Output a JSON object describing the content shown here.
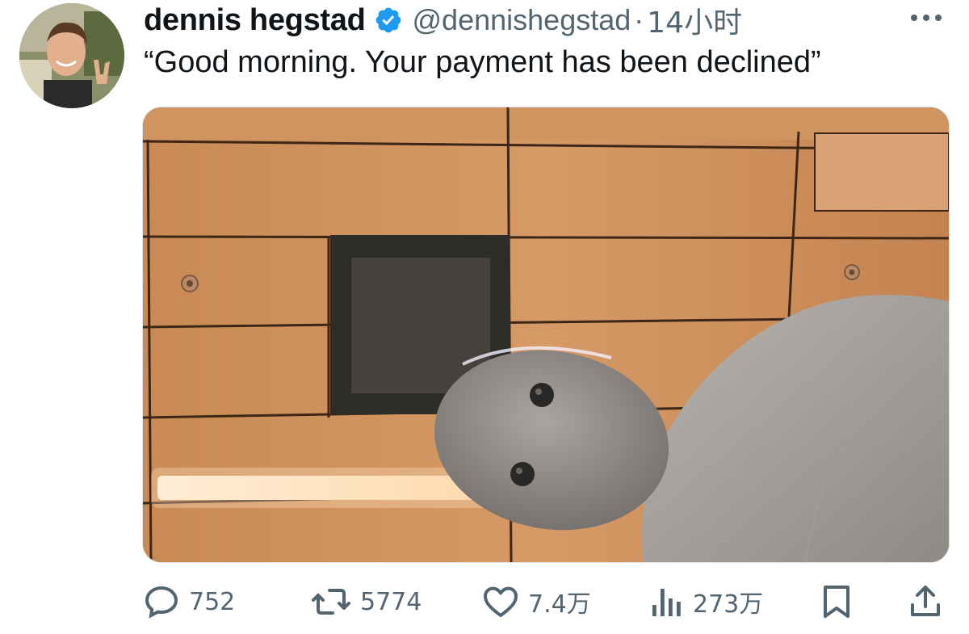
{
  "tweet": {
    "display_name": "dennis hegstad",
    "handle": "@dennishegstad",
    "separator": "·",
    "time": "14小时",
    "verified": true,
    "text": "“Good morning. Your payment has been declined”"
  },
  "actions": {
    "replies": "752",
    "retweets": "5774",
    "likes": "7.4万",
    "views": "273万"
  },
  "icons": {
    "reply": "speech-bubble-icon",
    "retweet": "retweet-arrows-icon",
    "like": "heart-icon",
    "views": "bar-chart-icon",
    "bookmark": "bookmark-icon",
    "share": "share-upload-icon",
    "more": "more-dots-icon",
    "verified": "verified-badge-icon"
  },
  "colors": {
    "text_primary": "#0f1419",
    "text_secondary": "#536471",
    "verified_blue": "#1d9bf0"
  }
}
